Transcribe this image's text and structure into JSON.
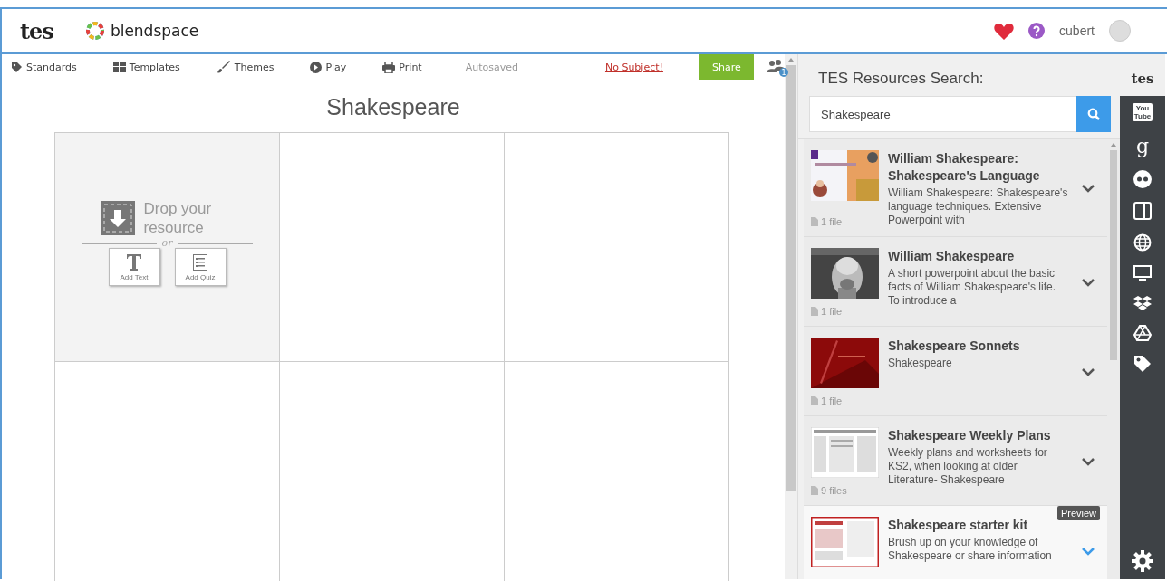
{
  "header": {
    "logo": "tes",
    "app_name": "blendspace",
    "user": "cubert"
  },
  "toolbar": {
    "items": [
      {
        "label": "Standards"
      },
      {
        "label": "Templates"
      },
      {
        "label": "Themes"
      },
      {
        "label": "Play"
      },
      {
        "label": "Print"
      }
    ],
    "status": "Autosaved",
    "subject_link": "No Subject!",
    "share_button": "Share",
    "collaborator_count": "1"
  },
  "lesson": {
    "title": "Shakespeare",
    "drop_zone": {
      "label": "Drop your resource",
      "separator": "or",
      "buttons": [
        {
          "label": "Add Text"
        },
        {
          "label": "Add Quiz"
        }
      ]
    }
  },
  "search_panel": {
    "title": "TES Resources Search:",
    "query": "Shakespeare",
    "results": [
      {
        "title": "William Shakespeare: Shakespeare's Language",
        "description": "William Shakespeare: Shakespeare's language techniques. Extensive Powerpoint with",
        "files": "1 file",
        "highlighted": false
      },
      {
        "title": "William Shakespeare",
        "description": "A short powerpoint about the basic facts of William Shakespeare's life. To introduce a",
        "files": "1 file",
        "highlighted": false
      },
      {
        "title": "Shakespeare Sonnets",
        "description": "Shakespeare",
        "files": "1 file",
        "highlighted": false
      },
      {
        "title": "Shakespeare Weekly Plans",
        "description": "Weekly plans and worksheets for KS2, when looking at older Literature- Shakespeare",
        "files": "9 files",
        "highlighted": false
      },
      {
        "title": "Shakespeare starter kit",
        "description": "Brush up on your knowledge of Shakespeare or share information",
        "highlighted": true,
        "tooltip": "Preview"
      }
    ]
  },
  "source_bar": {
    "logo": "tes",
    "youtube_top": "You",
    "youtube_bottom": "Tube",
    "google": "g"
  }
}
